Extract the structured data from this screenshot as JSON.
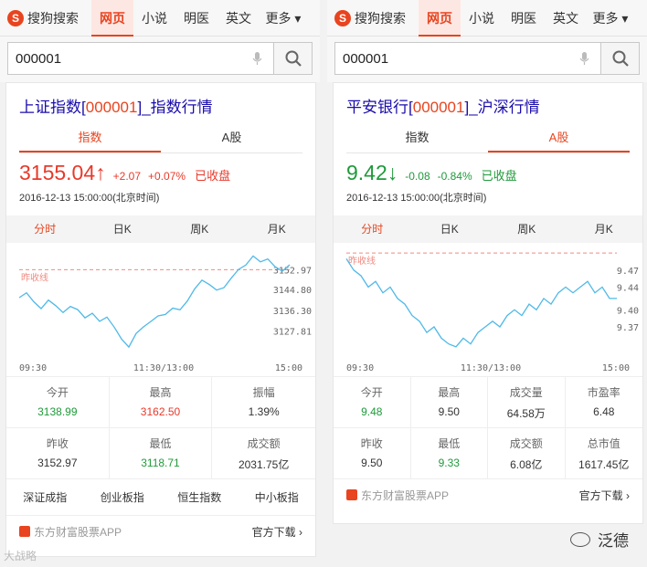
{
  "panels": [
    {
      "logo": "搜狗搜索",
      "nav": [
        "网页",
        "小说",
        "明医",
        "英文"
      ],
      "nav_more": "更多",
      "search_value": "000001",
      "title_prefix": "上证指数[",
      "title_code": "000001",
      "title_suffix": "]_指数行情",
      "tabs": [
        "指数",
        "A股"
      ],
      "active_tab": 0,
      "price": "3155.04↑",
      "change": "+2.07",
      "change_pct": "+0.07%",
      "status": "已收盘",
      "trend": "up",
      "timestamp": "2016-12-13 15:00:00(北京时间)",
      "chart_tabs": [
        "分时",
        "日K",
        "周K",
        "月K"
      ],
      "chart_data": {
        "type": "line",
        "prev_close_label": "昨收线",
        "x_ticks": [
          "09:30",
          "11:30/13:00",
          "15:00"
        ],
        "y_ticks": [
          "3152.97",
          "3144.80",
          "3136.30",
          "3127.81"
        ],
        "y_tick_values": [
          3152.97,
          3144.8,
          3136.3,
          3127.81
        ],
        "prev_close": 3152.97,
        "ylim": [
          3119,
          3161
        ],
        "values": [
          3141.5,
          3143.5,
          3139.8,
          3137.0,
          3140.5,
          3138.2,
          3135.4,
          3137.9,
          3136.6,
          3133.2,
          3135.1,
          3131.8,
          3133.5,
          3129.4,
          3124.5,
          3121.2,
          3126.8,
          3129.5,
          3131.7,
          3134.0,
          3134.6,
          3137.2,
          3136.5,
          3140.1,
          3145.1,
          3148.7,
          3146.9,
          3144.6,
          3145.6,
          3149.5,
          3153.1,
          3154.9,
          3158.6,
          3156.2,
          3157.4,
          3154.2,
          3152.4,
          3155.0
        ]
      },
      "stats": [
        {
          "label": "今开",
          "value": "3138.99",
          "color": "down"
        },
        {
          "label": "最高",
          "value": "3162.50",
          "color": "up"
        },
        {
          "label": "振幅",
          "value": "1.39%",
          "color": "none"
        },
        {
          "label": "昨收",
          "value": "3152.97",
          "color": "none"
        },
        {
          "label": "最低",
          "value": "3118.71",
          "color": "down"
        },
        {
          "label": "成交额",
          "value": "2031.75亿",
          "color": "none"
        }
      ],
      "index_links": [
        "深证成指",
        "创业板指",
        "恒生指数",
        "中小板指"
      ],
      "app_name": "东方财富股票APP",
      "download": "官方下载 ›"
    },
    {
      "logo": "搜狗搜索",
      "nav": [
        "网页",
        "小说",
        "明医",
        "英文"
      ],
      "nav_more": "更多",
      "search_value": "000001",
      "title_prefix": "平安银行[",
      "title_code": "000001",
      "title_suffix": "]_沪深行情",
      "tabs": [
        "指数",
        "A股"
      ],
      "active_tab": 1,
      "price": "9.42↓",
      "change": "-0.08",
      "change_pct": "-0.84%",
      "status": "已收盘",
      "trend": "down",
      "timestamp": "2016-12-13 15:00:00(北京时间)",
      "chart_tabs": [
        "分时",
        "日K",
        "周K",
        "月K"
      ],
      "chart_data": {
        "type": "line",
        "prev_close_label": "昨收线",
        "x_ticks": [
          "09:30",
          "11:30/13:00",
          "15:00"
        ],
        "y_ticks": [
          "9.47",
          "9.44",
          "9.40",
          "9.37"
        ],
        "y_tick_values": [
          9.47,
          9.44,
          9.4,
          9.37
        ],
        "prev_close": 9.5,
        "ylim": [
          9.325,
          9.505
        ],
        "values": [
          9.49,
          9.47,
          9.46,
          9.44,
          9.45,
          9.43,
          9.44,
          9.42,
          9.41,
          9.39,
          9.38,
          9.36,
          9.37,
          9.35,
          9.34,
          9.335,
          9.35,
          9.34,
          9.36,
          9.37,
          9.38,
          9.37,
          9.39,
          9.4,
          9.39,
          9.41,
          9.4,
          9.42,
          9.41,
          9.43,
          9.44,
          9.43,
          9.44,
          9.45,
          9.43,
          9.44,
          9.42,
          9.42
        ]
      },
      "stats": [
        {
          "label": "今开",
          "value": "9.48",
          "color": "down"
        },
        {
          "label": "最高",
          "value": "9.50",
          "color": "none"
        },
        {
          "label": "成交量",
          "value": "64.58万",
          "color": "none"
        },
        {
          "label": "市盈率",
          "value": "6.48",
          "color": "none"
        },
        {
          "label": "昨收",
          "value": "9.50",
          "color": "none"
        },
        {
          "label": "最低",
          "value": "9.33",
          "color": "down"
        },
        {
          "label": "成交额",
          "value": "6.08亿",
          "color": "none"
        },
        {
          "label": "总市值",
          "value": "1617.45亿",
          "color": "none"
        }
      ],
      "app_name": "东方财富股票APP",
      "download": "官方下载 ›"
    }
  ],
  "watermark": "泛德",
  "watermark_left": "大战略"
}
